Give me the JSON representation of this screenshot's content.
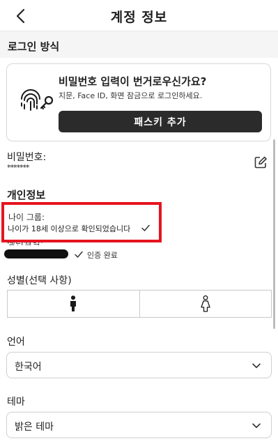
{
  "header": {
    "title": "계정 정보"
  },
  "login_section": {
    "heading": "로그인 방식"
  },
  "passkey": {
    "title": "비밀번호 입력이 번거로우신가요?",
    "subtitle": "지문, Face ID, 화면 잠금으로 로그인하세요.",
    "button_label": "패스키 추가"
  },
  "password": {
    "label": "비밀번호:",
    "value": "*******"
  },
  "personal": {
    "heading": "개인정보",
    "age_group": {
      "label": "나이 그룹:",
      "value": "나이가 18세 이상으로 확인되었습니다"
    },
    "birthdate": {
      "label": "생년월일:",
      "verified_text": "인증 완료"
    },
    "gender": {
      "label": "성별(선택 사항)",
      "options": [
        "male-icon",
        "female-icon"
      ]
    },
    "language": {
      "label": "언어",
      "value": "한국어"
    },
    "theme": {
      "label": "테마",
      "value": "밝은 테마"
    }
  },
  "colors": {
    "highlight": "#e5141f",
    "button_bg": "#2b2b2b",
    "band_bg": "#f5f5f5"
  }
}
